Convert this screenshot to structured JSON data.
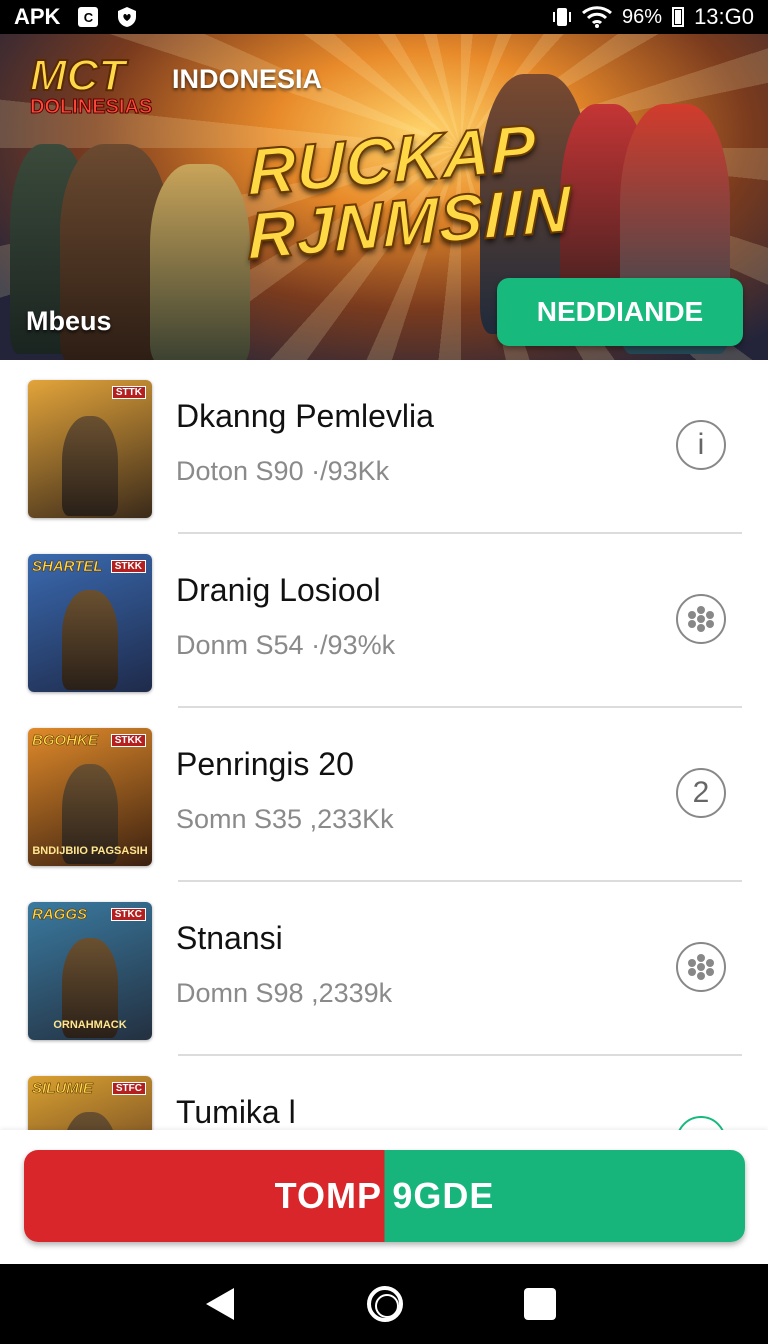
{
  "status_bar": {
    "left_label": "APK",
    "notif_icon_letter": "C",
    "battery": "96%",
    "time": "13:G0"
  },
  "banner": {
    "logo_line1": "MCT",
    "logo_line2": "DOLINESIAS",
    "country": "INDONESIA",
    "title_line1": "RUCKAP",
    "title_line2": "RJNMSIIN",
    "subtitle": "Mbeus",
    "cta_label": "NEDDIANDE"
  },
  "list": {
    "items": [
      {
        "title": "Dkanng Pemlevlia",
        "subtitle": "Doton S90 ·/93Kk",
        "thumb_title": "",
        "thumb_tag": "STTK",
        "thumb_caption": "",
        "action_icon": "info-icon",
        "action_text": "i",
        "thumb_color_top": "#e3a43a",
        "thumb_color_bottom": "#3a2a1a"
      },
      {
        "title": "Dranig Losiool",
        "subtitle": "Donm S54 ·/93%k",
        "thumb_title": "SHARTEL",
        "thumb_tag": "STKK",
        "thumb_caption": "",
        "action_icon": "dots-cluster-icon",
        "action_text": "",
        "thumb_color_top": "#3a6ab0",
        "thumb_color_bottom": "#1e2a4a"
      },
      {
        "title": "Penringis  20",
        "subtitle": "Somn S35 ,233Kk",
        "thumb_title": "BGOHKE",
        "thumb_tag": "STKK",
        "thumb_caption": "BNDIJBIIO PAGSASIH",
        "action_icon": "number-icon",
        "action_text": "2",
        "thumb_color_top": "#e08a2a",
        "thumb_color_bottom": "#3a2010"
      },
      {
        "title": "Stnansi",
        "subtitle": "Domn S98 ,2339k",
        "thumb_title": "RAGGS",
        "thumb_tag": "STKC",
        "thumb_caption": "ORNAHMACK",
        "action_icon": "dots-cluster-icon",
        "action_text": "",
        "thumb_color_top": "#3a7aa0",
        "thumb_color_bottom": "#233040"
      },
      {
        "title": "Tumika l",
        "subtitle": "",
        "thumb_title": "SILUMIE",
        "thumb_tag": "STFC",
        "thumb_caption": "",
        "action_icon": "circle-icon",
        "action_text": "",
        "thumb_color_top": "#d9a030",
        "thumb_color_bottom": "#4a2a20"
      }
    ]
  },
  "bottom_cta": {
    "label": "TOMP 9GDE"
  },
  "colors": {
    "accent_green": "#18b97d",
    "accent_red": "#d9262a"
  }
}
